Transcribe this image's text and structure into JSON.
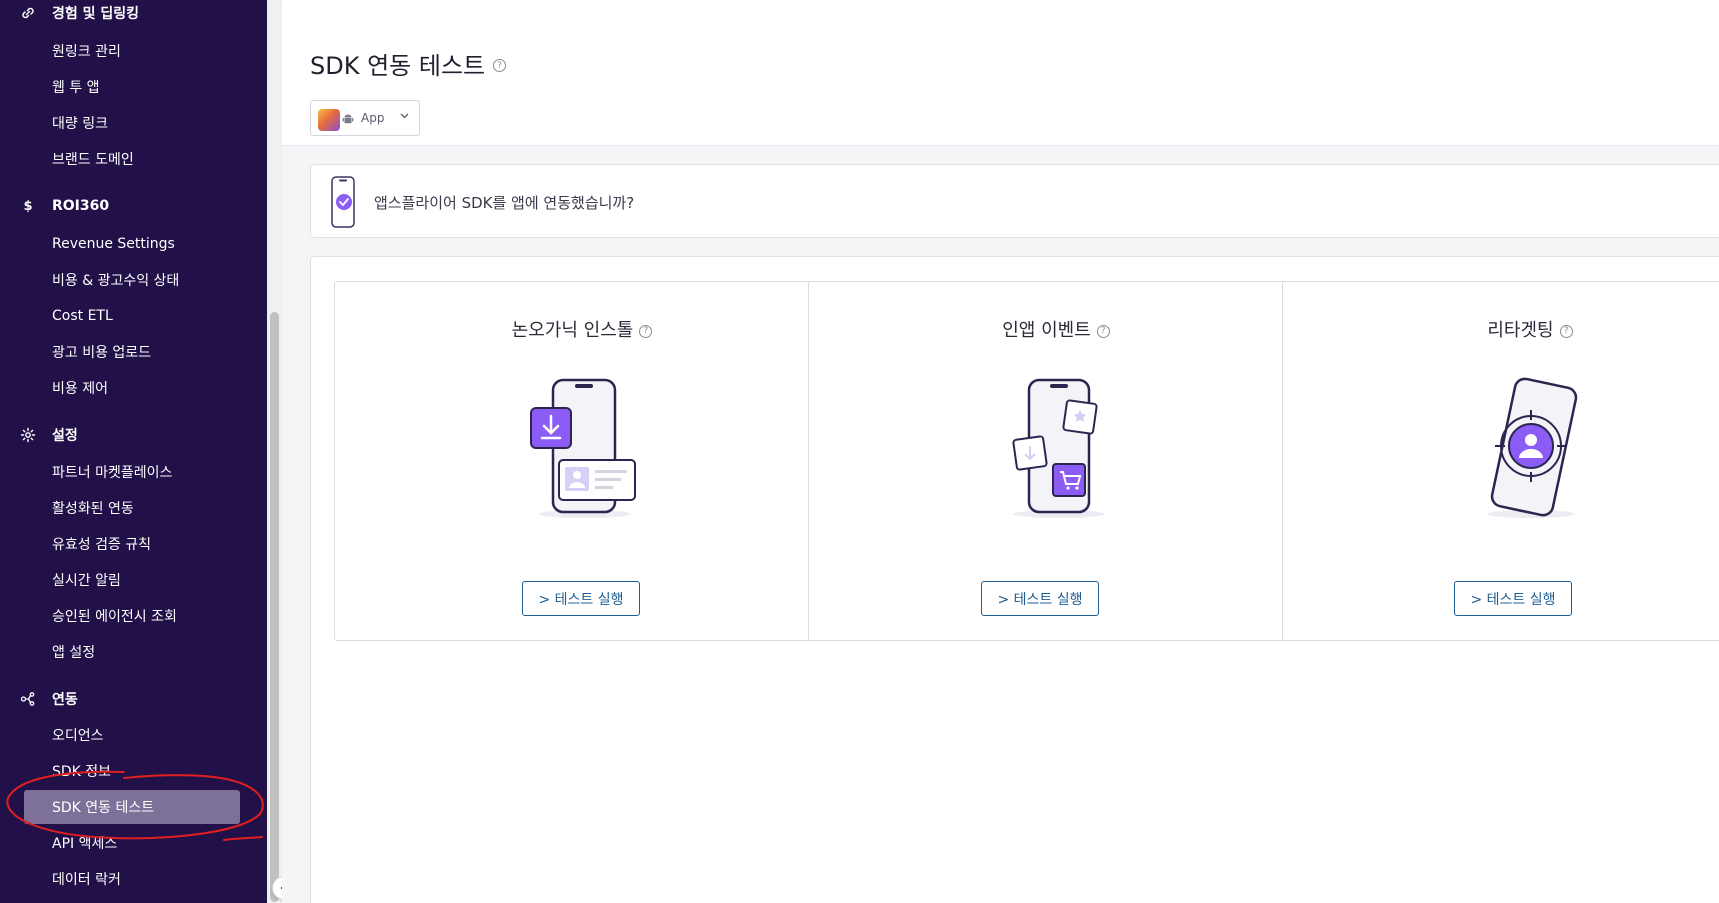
{
  "sidebar": {
    "sections": [
      {
        "icon": "link-icon",
        "label": "경험 및 딥링킹",
        "items": [
          "원링크 관리",
          "웹 투 앱",
          "대량 링크",
          "브랜드 도메인"
        ]
      },
      {
        "icon": "dollar-icon",
        "label": "ROI360",
        "items": [
          "Revenue Settings",
          "비용 & 광고수익 상태",
          "Cost ETL",
          "광고 비용 업로드",
          "비용 제어"
        ]
      },
      {
        "icon": "gear-icon",
        "label": "설정",
        "items": [
          "파트너 마켓플레이스",
          "활성화된 연동",
          "유효성 검증 규칙",
          "실시간 알림",
          "승인된 에이전시 조회",
          "앱 설정"
        ]
      },
      {
        "icon": "integration-icon",
        "label": "연동",
        "items": [
          "오디언스",
          "SDK 정보",
          "SDK 연동 테스트",
          "API 액세스",
          "데이터 락커"
        ]
      }
    ],
    "active_item": "SDK 연동 테스트",
    "collapse_icon": "chevron-left-icon"
  },
  "page": {
    "title": "SDK 연동 테스트",
    "app_selector": {
      "label": "App",
      "platform_icon": "android-icon"
    },
    "banner": {
      "text": "앱스플라이어 SDK를 앱에 연동했습니까?"
    }
  },
  "cards": [
    {
      "title": "논오가닉 인스톨",
      "button": "> 테스트 실행"
    },
    {
      "title": "인앱 이벤트",
      "button": "> 테스트 실행"
    },
    {
      "title": "리타겟팅",
      "button": "> 테스트 실행"
    }
  ],
  "colors": {
    "sidebar_bg": "#221048",
    "active_item_bg": "#7d7199",
    "accent_purple": "#8b5cf6",
    "button_blue": "#1f5d93",
    "annotation_red": "#e02020"
  }
}
